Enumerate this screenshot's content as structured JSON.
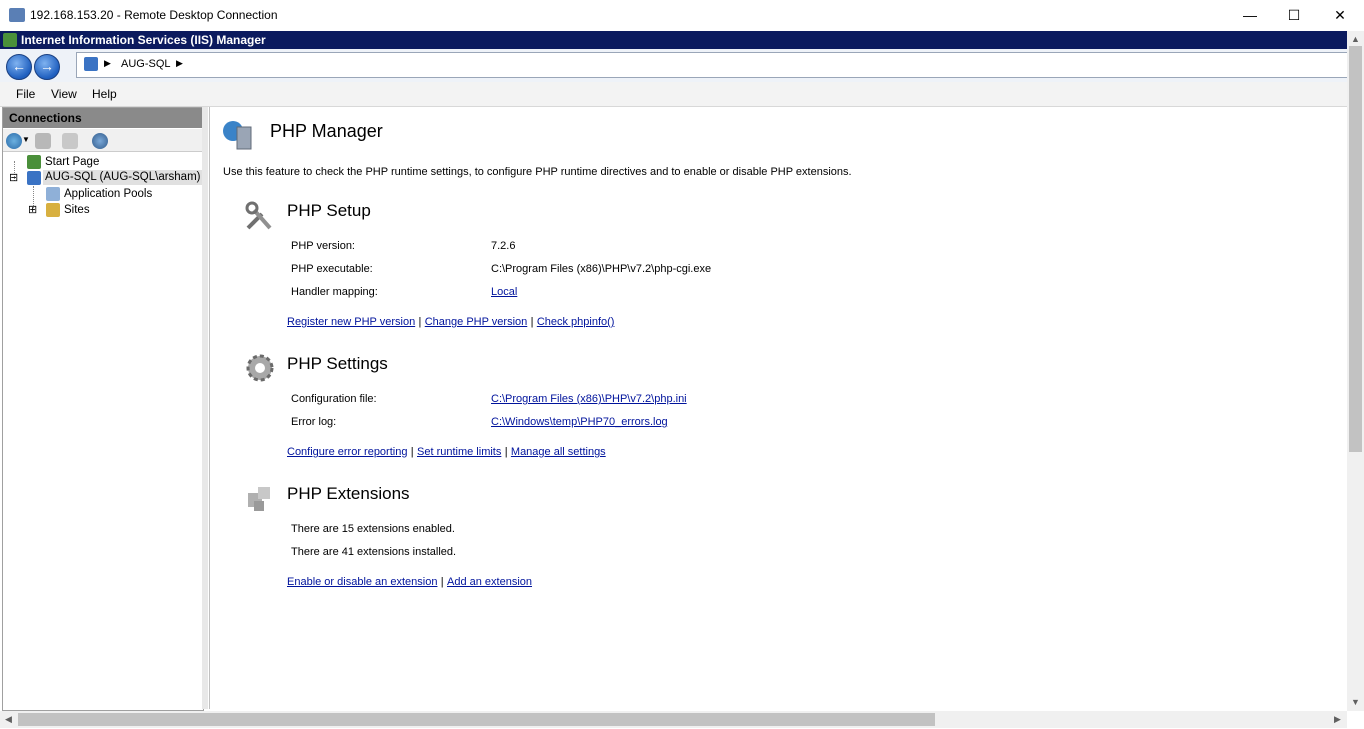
{
  "rdp": {
    "title": "192.168.153.20 - Remote Desktop Connection",
    "minimize": "—",
    "maximize": "☐",
    "close": "✕"
  },
  "iis": {
    "title": "Internet Information Services (IIS) Manager",
    "back_label": "←",
    "forward_label": "→",
    "breadcrumb": [
      "AUG-SQL"
    ],
    "menu": [
      "File",
      "View",
      "Help"
    ]
  },
  "connections": {
    "header": "Connections",
    "tree": [
      {
        "label": "Start Page"
      },
      {
        "label": "AUG-SQL (AUG-SQL\\arsham)",
        "expander": "⊟"
      },
      {
        "label": "Application Pools"
      },
      {
        "label": "Sites",
        "expander": "⊞"
      }
    ]
  },
  "page": {
    "title": "PHP Manager",
    "description": "Use this feature to check the PHP runtime settings, to configure PHP runtime directives and to enable or disable PHP extensions.",
    "setup": {
      "title": "PHP Setup",
      "rows": [
        {
          "label": "PHP version:",
          "value": "7.2.6"
        },
        {
          "label": "PHP executable:",
          "value": "C:\\Program Files (x86)\\PHP\\v7.2\\php-cgi.exe"
        },
        {
          "label": "Handler mapping:",
          "value": "Local"
        }
      ],
      "links": [
        "Register new PHP version",
        "Change PHP version",
        "Check phpinfo()"
      ]
    },
    "settings": {
      "title": "PHP Settings",
      "rows": [
        {
          "label": "Configuration file:",
          "value": "C:\\Program Files (x86)\\PHP\\v7.2\\php.ini"
        },
        {
          "label": "Error log:",
          "value": "C:\\Windows\\temp\\PHP70_errors.log"
        }
      ],
      "links": [
        "Configure error reporting",
        "Set runtime limits",
        "Manage all settings"
      ]
    },
    "extensions": {
      "title": "PHP Extensions",
      "lines": [
        "There are 15 extensions enabled.",
        "There are 41 extensions installed."
      ],
      "links": [
        "Enable or disable an extension",
        "Add an extension"
      ]
    },
    "separator": "|"
  },
  "scroll": {
    "up": "▲",
    "down": "▼",
    "left": "◀",
    "right": "▶"
  }
}
